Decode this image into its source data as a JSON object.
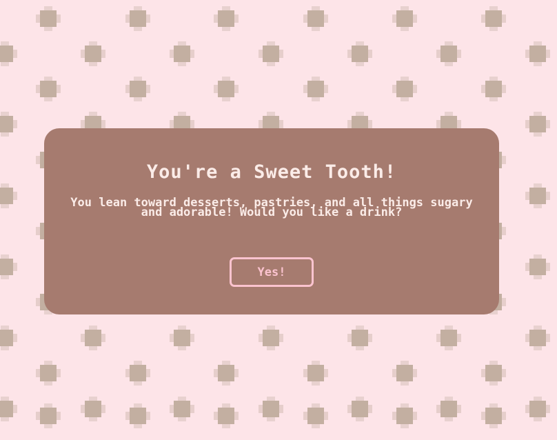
{
  "background": {
    "color": "#fde4e8",
    "pattern": "pixel-checker-squares",
    "square_color": "#b9a694"
  },
  "dialog": {
    "title": "You're a Sweet Tooth!",
    "message": "You lean toward desserts, pastries, and all things sugary and adorable! Would you like a drink?",
    "confirm_label": "Yes!",
    "panel_color": "#a67b6f",
    "accent_color": "#fbc3cf"
  }
}
